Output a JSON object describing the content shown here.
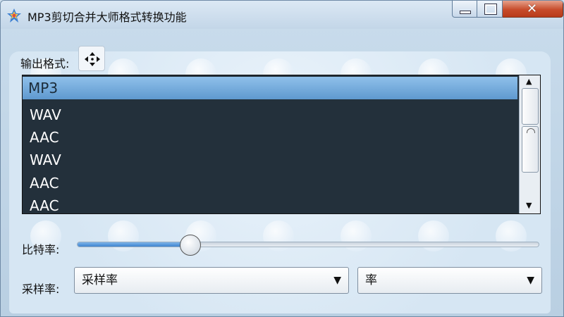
{
  "window": {
    "title": "MP3剪切合并大师格式转换功能",
    "close_glyph": "✕",
    "min_icon": "minimize-icon",
    "max_icon": "maximize-icon"
  },
  "output_format": {
    "label": "输出格式:",
    "move_icon": "move-arrows-icon",
    "items": [
      "MP3",
      "WAV",
      "AAC",
      "WAV",
      "AAC",
      "AAC"
    ],
    "selected_index": 0
  },
  "bitrate": {
    "label": "比特率:",
    "level": 0.245
  },
  "sample_rate": {
    "label": "采样率:",
    "select_value": "采样率"
  },
  "channel": {
    "select_value": "率"
  },
  "colors": {
    "list_bg": "#23303b",
    "selection": "#6fa8dc",
    "slider_fill": "#4a8fd6",
    "close": "#c74c2b"
  }
}
